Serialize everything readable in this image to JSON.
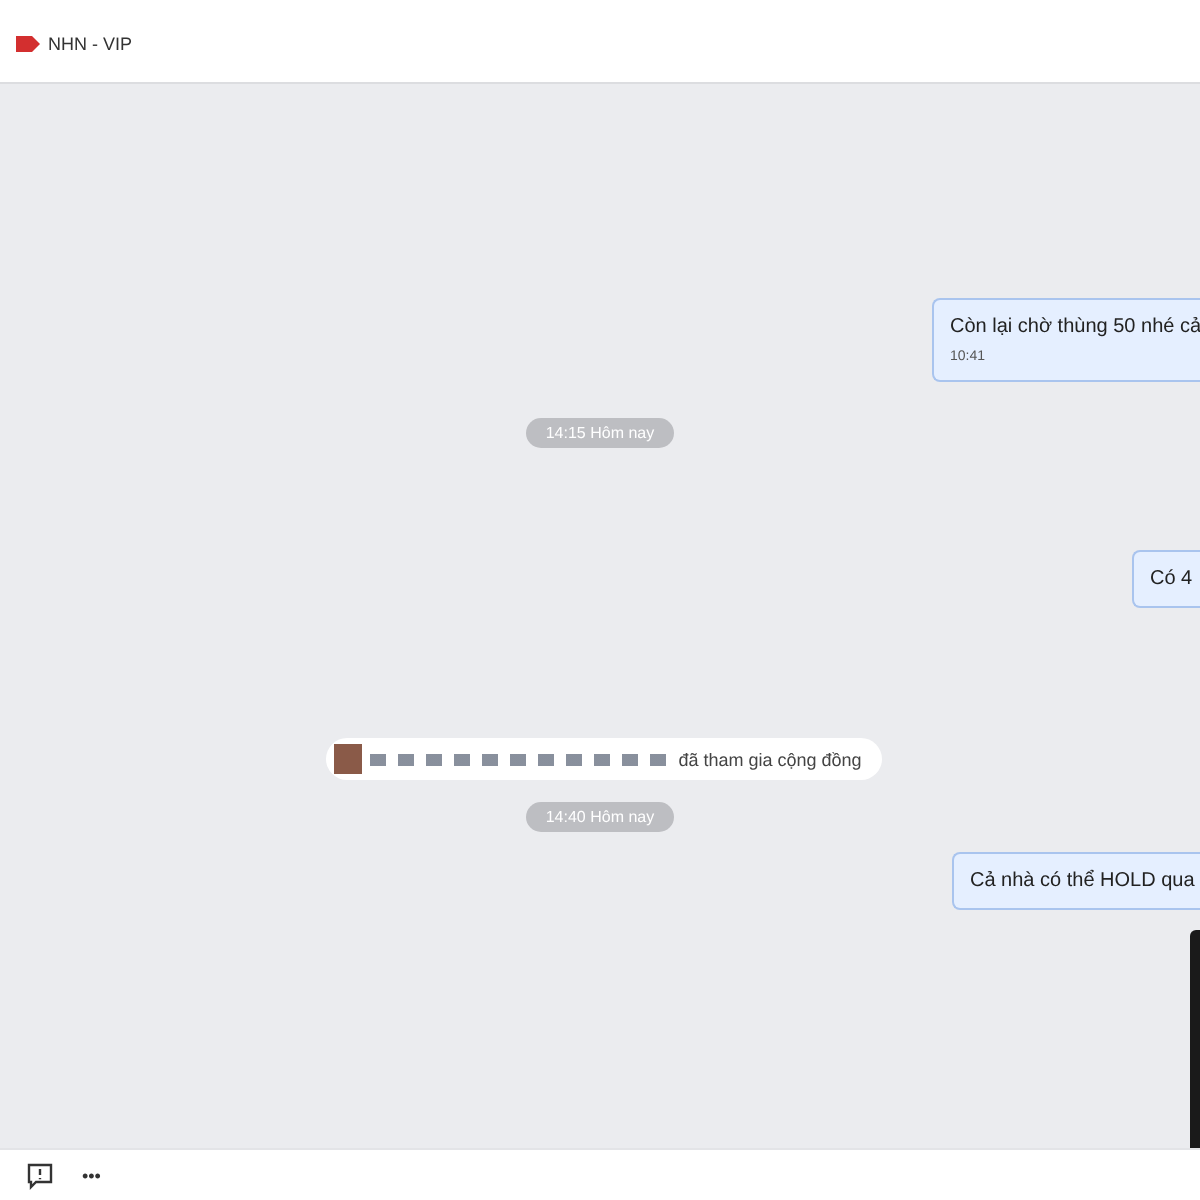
{
  "header": {
    "title": "NHN - VIP"
  },
  "messages": [
    {
      "kind": "outgoing",
      "text": "Còn lại chờ thùng 50 nhé cả",
      "time": "10:41"
    },
    {
      "kind": "date",
      "text": "14:15 Hôm nay"
    },
    {
      "kind": "outgoing",
      "text": "Có 4"
    },
    {
      "kind": "join",
      "text": "đã tham gia cộng đồng"
    },
    {
      "kind": "date",
      "text": "14:40 Hôm nay"
    },
    {
      "kind": "outgoing",
      "text": "Cả nhà có thể HOLD qua"
    },
    {
      "kind": "media"
    }
  ],
  "footer": {
    "more": "•••"
  }
}
